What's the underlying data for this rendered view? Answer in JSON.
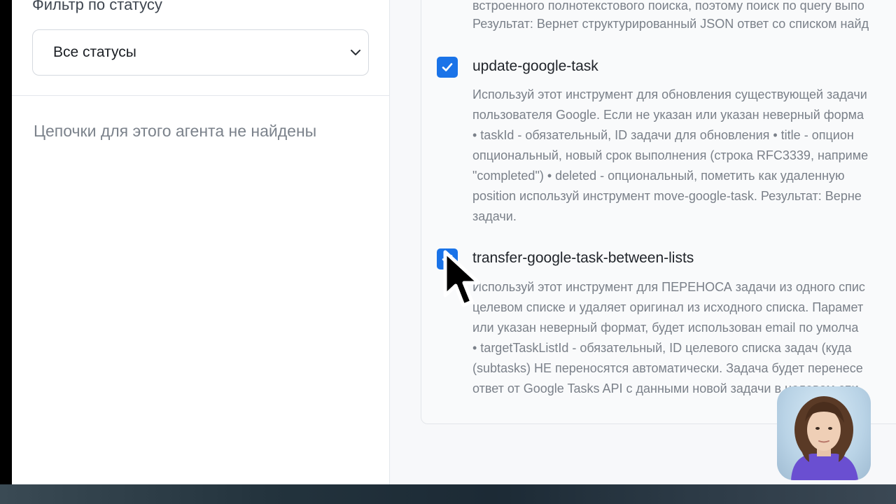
{
  "filter": {
    "label": "Фильтр по статусу",
    "selected": "Все статусы"
  },
  "chains": {
    "empty_message": "Цепочки для этого агента не найдены"
  },
  "tools": {
    "top_desc": [
      "встроенного полнотекстового поиска, поэтому поиск по query выпо",
      "Результат: Вернет структурированный JSON ответ со списком найд"
    ],
    "items": [
      {
        "name": "update-google-task",
        "checked": true,
        "desc": [
          "Используй этот инструмент для обновления существующей задачи",
          "пользователя Google. Если не указан или указан неверный форма",
          "• taskId - обязательный, ID задачи для обновления • title - опцион",
          "опциональный, новый срок выполнения (строка RFC3339, наприме",
          "\"completed\") • deleted - опциональный, пометить как удаленную",
          "position используй инструмент move-google-task. Результат: Верне",
          "задачи."
        ]
      },
      {
        "name": "transfer-google-task-between-lists",
        "checked": true,
        "desc": [
          "Используй этот инструмент для ПЕРЕНОСА задачи из одного спис",
          "целевом списке и удаляет оригинал из исходного списка. Парамет",
          "или указан неверный формат, будет использован email по умолча",
          "• targetTaskListId - обязательный, ID целевого списка задач (куда",
          "(subtasks) НЕ переносятся автоматически. Задача будет перенесе",
          "ответ от Google Tasks API с данными новой задачи в целевом спи"
        ]
      }
    ]
  },
  "colors": {
    "accent": "#1a73e8",
    "muted_text": "#7a8089",
    "title_text": "#1f2329"
  },
  "icons": {
    "select_chevron": "chevron-down-icon",
    "checkbox": "checkmark-icon",
    "cursor": "mouse-pointer-icon"
  }
}
